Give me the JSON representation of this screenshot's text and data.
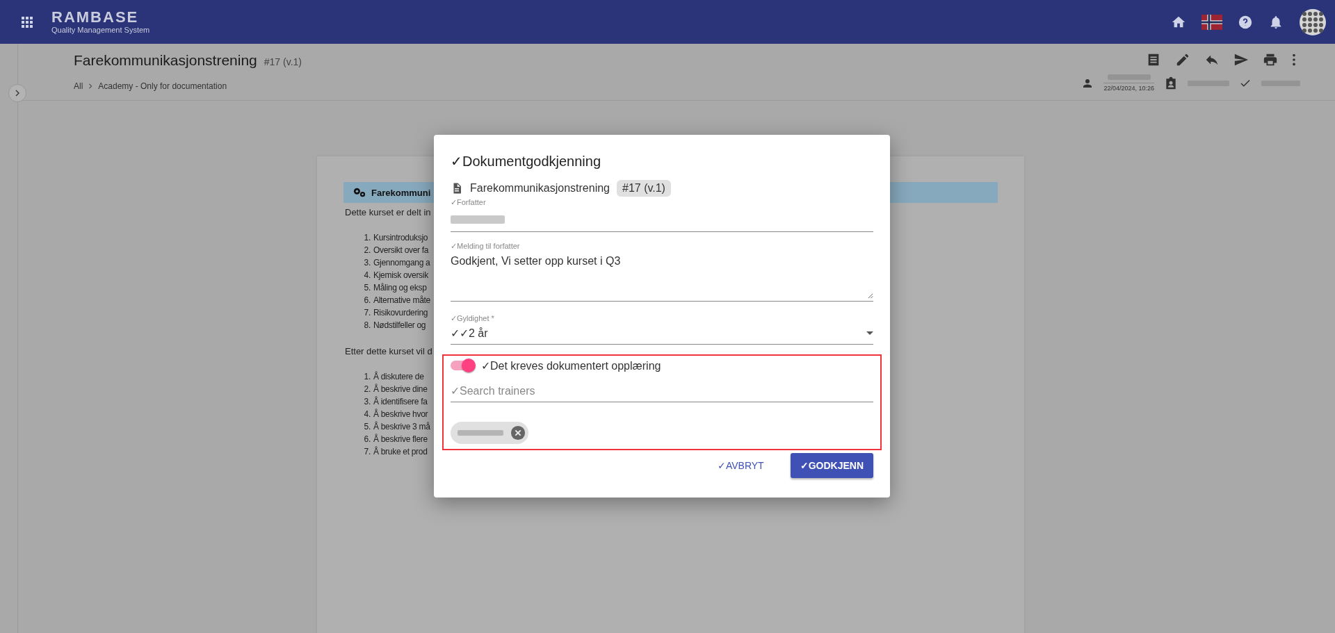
{
  "app": {
    "name": "RAMBASE",
    "subtitle": "Quality Management System"
  },
  "document": {
    "title": "Farekommunikasjonstrening",
    "version": "#17 (v.1)",
    "breadcrumb": [
      "All",
      "Academy - Only for documentation"
    ],
    "modified": "22/04/2024, 10:26"
  },
  "content": {
    "heading": "Farekommuni",
    "intro": "Dette kurset er delt in",
    "modules": [
      {
        "number": "1.",
        "text": "Kursintroduksjo"
      },
      {
        "number": "2.",
        "text": "Oversikt over fa"
      },
      {
        "number": "3.",
        "text": "Gjennomgang a"
      },
      {
        "number": "4.",
        "text": "Kjemisk oversik"
      },
      {
        "number": "5.",
        "text": "Måling og eksp"
      },
      {
        "number": "6.",
        "text": "Alternative måte"
      },
      {
        "number": "7.",
        "text": "Risikovurdering"
      },
      {
        "number": "8.",
        "text": "Nødstilfeller og"
      }
    ],
    "outro": "Etter dette kurset vil d",
    "goals": [
      {
        "number": "1.",
        "text": "Å diskutere de"
      },
      {
        "number": "2.",
        "text": "Å beskrive dine"
      },
      {
        "number": "3.",
        "text": "Å identifisere fa"
      },
      {
        "number": "4.",
        "text": "Å beskrive hvor"
      },
      {
        "number": "5.",
        "text": "Å beskrive 3 må"
      },
      {
        "number": "6.",
        "text": "Å beskrive flere"
      },
      {
        "number": "7.",
        "text": "Å bruke et prod"
      }
    ]
  },
  "dialog": {
    "title": "✓Dokumentgodkjenning",
    "document": "Farekommunikasjonstrening",
    "version": "#17 (v.1)",
    "author_label": "✓Forfatter",
    "message_label": "✓Melding til forfatter",
    "message": "Godkjent, Vi setter opp kurset i Q3",
    "validity_label": "✓Gyldighet *",
    "validity": "✓✓2 år",
    "training": {
      "on": true,
      "label": "✓Det kreves dokumentert opplæring"
    },
    "search": {
      "placeholder": "✓Search trainers"
    },
    "buttons": [
      {
        "label": "✓AVBRYT",
        "kind": "text"
      },
      {
        "label": "✓GODKJENN",
        "kind": "primary"
      }
    ]
  }
}
